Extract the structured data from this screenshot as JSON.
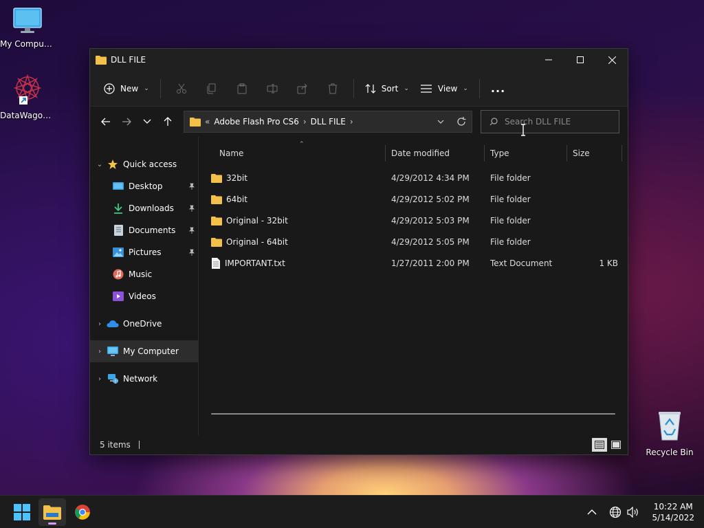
{
  "desktop": {
    "icons": [
      {
        "label": "My Computer"
      },
      {
        "label": "DataWagon..."
      },
      {
        "label": "Recycle Bin"
      }
    ]
  },
  "window": {
    "title": "DLL FILE",
    "controls": {
      "minimize": "minimize",
      "maximize": "maximize",
      "close": "close"
    }
  },
  "toolbar": {
    "new_label": "New",
    "sort_label": "Sort",
    "view_label": "View",
    "more_label": "..."
  },
  "address": {
    "overflow": "«",
    "crumbs": [
      "Adobe Flash Pro CS6",
      "DLL FILE"
    ]
  },
  "search": {
    "placeholder": "Search DLL FILE"
  },
  "sidebar": {
    "quick_access": "Quick access",
    "items": [
      {
        "label": "Desktop",
        "icon": "desktop-icon",
        "pinned": true
      },
      {
        "label": "Downloads",
        "icon": "downloads-icon",
        "pinned": true
      },
      {
        "label": "Documents",
        "icon": "documents-icon",
        "pinned": true
      },
      {
        "label": "Pictures",
        "icon": "pictures-icon",
        "pinned": true
      },
      {
        "label": "Music",
        "icon": "music-icon",
        "pinned": false
      },
      {
        "label": "Videos",
        "icon": "videos-icon",
        "pinned": false
      }
    ],
    "onedrive": "OneDrive",
    "my_computer": "My Computer",
    "network": "Network"
  },
  "columns": {
    "name": "Name",
    "date": "Date modified",
    "type": "Type",
    "size": "Size"
  },
  "files": [
    {
      "name": "32bit",
      "date": "4/29/2012 4:34 PM",
      "type": "File folder",
      "size": "",
      "kind": "folder"
    },
    {
      "name": "64bit",
      "date": "4/29/2012 5:02 PM",
      "type": "File folder",
      "size": "",
      "kind": "folder"
    },
    {
      "name": "Original - 32bit",
      "date": "4/29/2012 5:03 PM",
      "type": "File folder",
      "size": "",
      "kind": "folder"
    },
    {
      "name": "Original - 64bit",
      "date": "4/29/2012 5:05 PM",
      "type": "File folder",
      "size": "",
      "kind": "folder"
    },
    {
      "name": "IMPORTANT.txt",
      "date": "1/27/2011 2:00 PM",
      "type": "Text Document",
      "size": "1 KB",
      "kind": "text"
    }
  ],
  "status": {
    "items_count": "5 items"
  },
  "taskbar": {
    "time": "10:22 AM",
    "date": "5/14/2022"
  },
  "colors": {
    "accent": "#4cc2ff",
    "folder": "#f3c14a",
    "selected_bg": "#2d2d2d"
  }
}
